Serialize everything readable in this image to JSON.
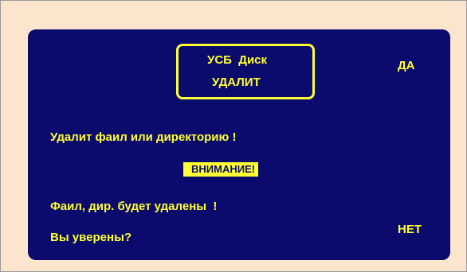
{
  "colors": {
    "background": "#fce5cd",
    "panel": "#0b0b6e",
    "text": "#ffff33"
  },
  "dialog": {
    "title_line1": "УСБ  Диск",
    "title_line2": "УДАЛИТ",
    "soft_yes": "ДА",
    "soft_no": "НЕТ",
    "message1": "Удалит фаил или директорию !",
    "warning": "ВНИМАНИЕ!",
    "message2": "Фаил, дир. будет удалены  !",
    "question": "Вы уверены?"
  }
}
